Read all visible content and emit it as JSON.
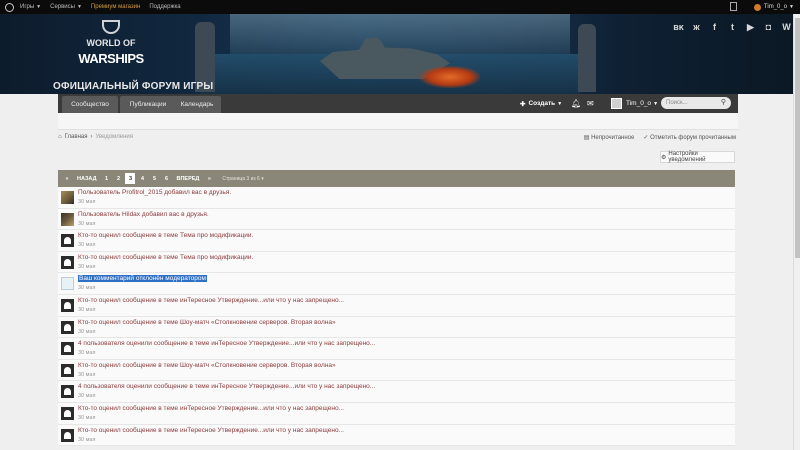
{
  "topbar": {
    "items": [
      {
        "label": "Игры"
      },
      {
        "label": "Сервисы"
      },
      {
        "label": "Премиум магазин"
      },
      {
        "label": "Поддержка"
      }
    ],
    "user": "Tim_0_o"
  },
  "banner": {
    "logo_line1": "WORLD OF",
    "logo_line2": "WARSHIPS",
    "forum_title": "ОФИЦИАЛЬНЫЙ ФОРУМ ИГРЫ",
    "social": [
      "vk-icon",
      "ok-icon",
      "facebook-icon",
      "twitter-icon",
      "youtube-icon",
      "twitch-icon",
      "wiki-icon"
    ]
  },
  "nav": {
    "tabs": [
      "Сообщество",
      "Публикации",
      "Календарь"
    ],
    "create": "Создать",
    "user": "Tim_0_o",
    "search_placeholder": "Поиск..."
  },
  "breadcrumb": {
    "home": "Главная",
    "current": "Уведомления"
  },
  "actions": {
    "unread": "Непрочитанное",
    "mark_read": "Отметить форум прочитанным",
    "settings": "Настройки уведомлений"
  },
  "pager": {
    "prev": "НАЗАД",
    "next": "ВПЕРЕД",
    "pages": [
      "1",
      "2",
      "3",
      "4",
      "5",
      "6"
    ],
    "info": "Страница 3 из 6"
  },
  "notifications": [
    {
      "text": "Пользователь Profitrol_2015 добавил вас в друзья.",
      "date": "30 мая"
    },
    {
      "text": "Пользователь Hildax добавил вас в друзья.",
      "date": "30 мая"
    },
    {
      "text": "Кто-то оценил сообщение в теме Тема про модификации.",
      "date": "30 мая"
    },
    {
      "text": "Кто-то оценил сообщение в теме Тема про модификации.",
      "date": "30 мая"
    },
    {
      "text": "Ваш комментарий отклонён модератором",
      "date": "30 мая"
    },
    {
      "text": "Кто-то оценил сообщение в теме инТересное Утверждение...или что у нас запрещено...",
      "date": "30 мая"
    },
    {
      "text": "Кто-то оценил сообщение в теме Шоу-матч «Столкновение серверов. Вторая волна»",
      "date": "30 мая"
    },
    {
      "text": "4 пользователя оценили сообщение в теме инТересное Утверждение...или что у нас запрещено...",
      "date": "30 мая"
    },
    {
      "text": "Кто-то оценил сообщение в теме Шоу-матч «Столкновение серверов. Вторая волна»",
      "date": "30 мая"
    },
    {
      "text": "4 пользователя оценили сообщение в теме инТересное Утверждение...или что у нас запрещено...",
      "date": "30 мая"
    },
    {
      "text": "Кто-то оценил сообщение в теме инТересное Утверждение...или что у нас запрещено...",
      "date": "30 мая"
    },
    {
      "text": "Кто-то оценил сообщение в теме инТересное Утверждение...или что у нас запрещено...",
      "date": "30 мая"
    }
  ]
}
